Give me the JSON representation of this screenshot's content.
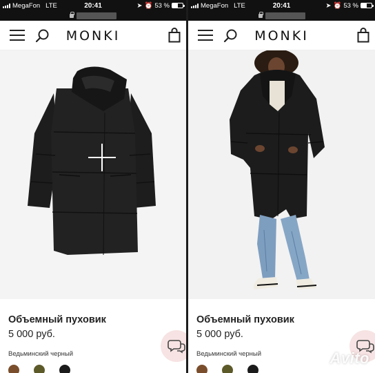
{
  "status_bar": {
    "carrier": "MegaFon",
    "network": "LTE",
    "time": "20:41",
    "battery": "53 %",
    "battery_level": 0.53
  },
  "brand": {
    "logo": "MONKI"
  },
  "icons": {
    "menu": "hamburger-menu-icon",
    "search": "search-icon",
    "bag": "shopping-bag-icon",
    "chat": "chat-icon",
    "lock": "lock-icon",
    "zoom": "plus-icon"
  },
  "screens": [
    {
      "product": {
        "name": "Объемный пуховик",
        "price": "5 000 руб.",
        "color_label": "Ведьминский черный"
      },
      "swatches": [
        "#7a4e2c",
        "#5d5a2a",
        "#1b1b1b"
      ]
    },
    {
      "product": {
        "name": "Объемный пуховик",
        "price": "5 000 руб.",
        "color_label": "Ведьминский черный"
      },
      "swatches": [
        "#7a4e2c",
        "#5d5a2a",
        "#1b1b1b"
      ]
    }
  ],
  "watermark": "Avito"
}
